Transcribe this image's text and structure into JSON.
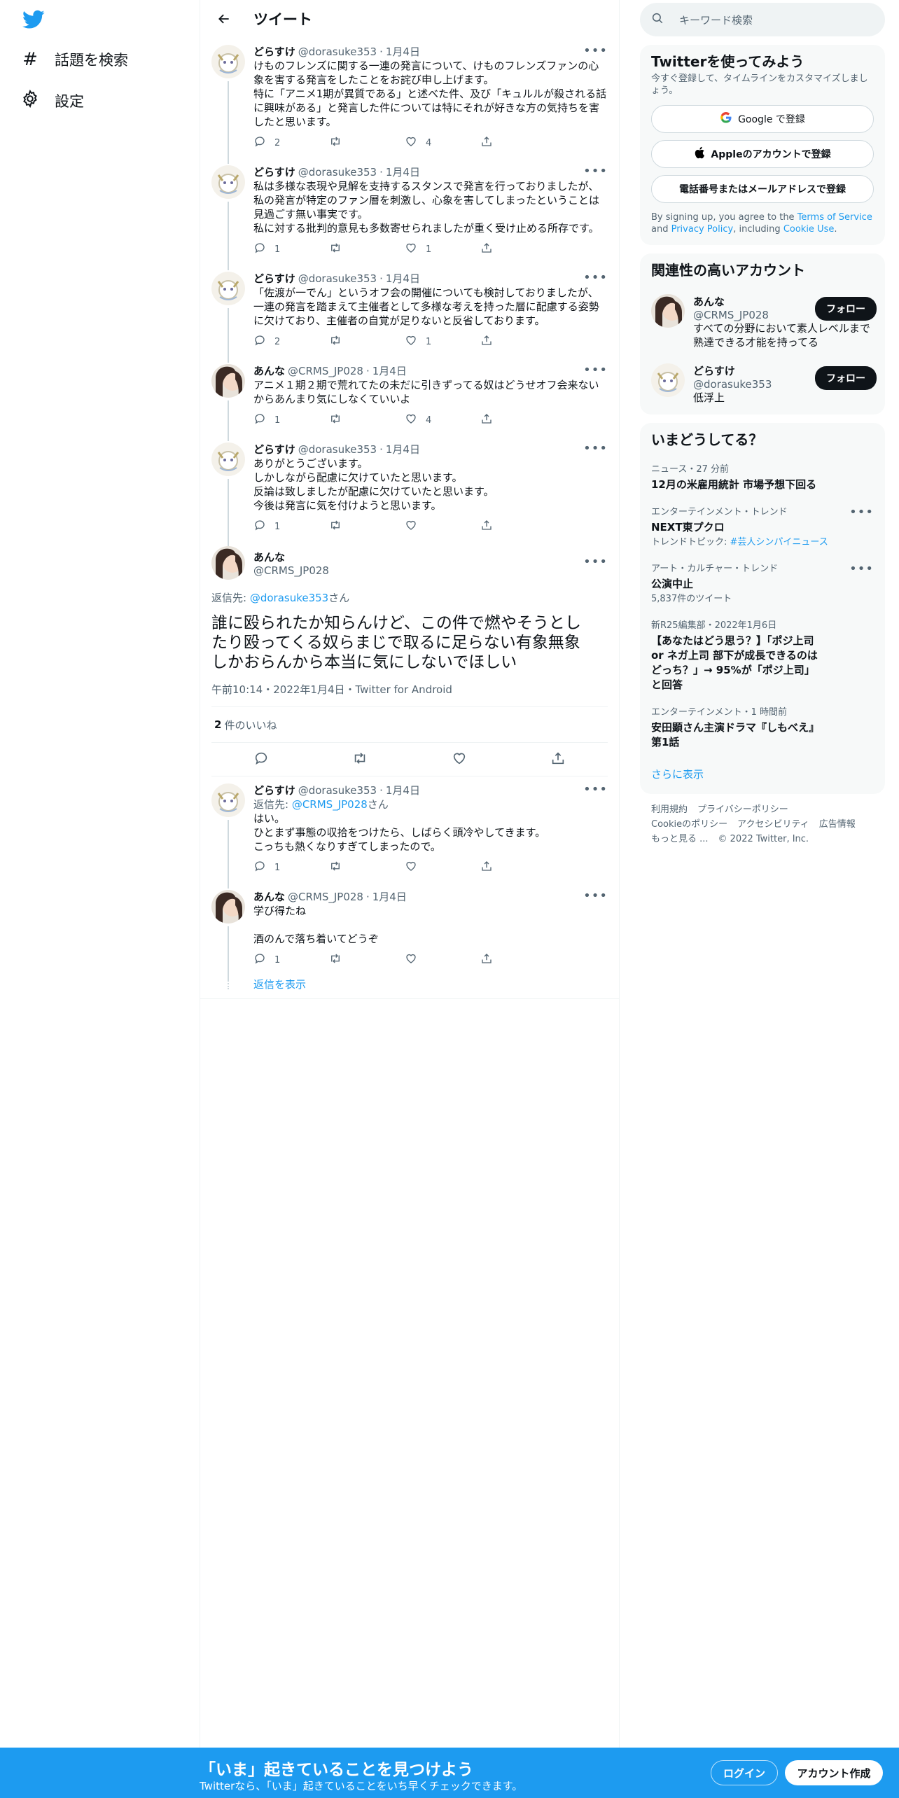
{
  "nav": {
    "explore_label": "話題を検索",
    "settings_label": "設定"
  },
  "header": {
    "title": "ツイート"
  },
  "thread": [
    {
      "name": "どらすけ",
      "handle": "@dorasuke353",
      "date": "1月4日",
      "avatar": "dorasuke",
      "text": "けものフレンズに関する一連の発言について、けものフレンズファンの心\n象を害する発言をしたことをお詫び申し上げます。\n特に「アニメ1期が異質である」と述べた件、及び「キュルルが殺される話\nに興味がある」と発言した件については特にそれが好きな方の気持ちを害\nしたと思います。",
      "replies": "2",
      "retweets": "",
      "likes": "4"
    },
    {
      "name": "どらすけ",
      "handle": "@dorasuke353",
      "date": "1月4日",
      "avatar": "dorasuke",
      "text": "私は多様な表現や見解を支持するスタンスで発言を行っておりましたが、\n私の発言が特定のファン層を刺激し、心象を害してしまったということは\n見過ごす無い事実です。\n私に対する批判的意見も多数寄せられましたが重く受け止める所存です。",
      "replies": "1",
      "retweets": "",
      "likes": "1"
    },
    {
      "name": "どらすけ",
      "handle": "@dorasuke353",
      "date": "1月4日",
      "avatar": "dorasuke",
      "text": "「佐渡が一でん」というオフ会の開催についても検討しておりましたが、\n一連の発言を踏まえて主催者として多様な考えを持った層に配慮する姿勢\nに欠けており、主催者の自覚が足りないと反省しております。",
      "replies": "2",
      "retweets": "",
      "likes": "1"
    },
    {
      "name": "あんな",
      "handle": "@CRMS_JP028",
      "date": "1月4日",
      "avatar": "anna",
      "text": "アニメ１期２期で荒れてたの未だに引きずってる奴はどうせオフ会来ない\nからあんまり気にしなくていいよ",
      "replies": "1",
      "retweets": "",
      "likes": "4"
    },
    {
      "name": "どらすけ",
      "handle": "@dorasuke353",
      "date": "1月4日",
      "avatar": "dorasuke",
      "text": "ありがとうございます。\nしかしながら配慮に欠けていたと思います。\n反論は致しましたが配慮に欠けていたと思います。\n今後は発言に気を付けようと思います。",
      "replies": "1",
      "retweets": "",
      "likes": ""
    }
  ],
  "main_tweet": {
    "name": "あんな",
    "handle": "@CRMS_JP028",
    "reply_prefix": "返信先: ",
    "reply_to": "@dorasuke353",
    "reply_suffix": "さん",
    "text": "誰に殴られたか知らんけど、この件で燃やそうとし\nたり殴ってくる奴らまじで取るに足らない有象無象\nしかおらんから本当に気にしないでほしい",
    "time": "午前10:14・2022年1月4日・Twitter for Android",
    "likes_count": "2",
    "likes_label": "件のいいね"
  },
  "replies": [
    {
      "name": "どらすけ",
      "handle": "@dorasuke353",
      "date": "1月4日",
      "avatar": "dorasuke",
      "reply_prefix": "返信先: ",
      "reply_to": "@CRMS_JP028",
      "reply_suffix": "さん",
      "text": "はい。\nひとまず事態の収拾をつけたら、しばらく頭冷やしてきます。\nこっちも熱くなりすぎてしまったので。",
      "replies": "1",
      "retweets": "",
      "likes": ""
    },
    {
      "name": "あんな",
      "handle": "@CRMS_JP028",
      "date": "1月4日",
      "avatar": "anna",
      "text": "学び得たね\n\n酒のんで落ち着いてどうぞ",
      "replies": "1",
      "retweets": "",
      "likes": ""
    }
  ],
  "show_replies": "返信を表示",
  "sidebar": {
    "search_placeholder": "キーワード検索",
    "signup": {
      "title": "Twitterを使ってみよう",
      "subtitle": "今すぐ登録して、タイムラインをカスタマイズしましょう。",
      "google": "Google で登録",
      "apple": "Appleのアカウントで登録",
      "phone": "電話番号またはメールアドレスで登録",
      "terms_pre": "By signing up, you agree to the ",
      "terms": "Terms of Service",
      "terms_and": " and ",
      "privacy": "Privacy Policy",
      "including": ", including ",
      "cookie": "Cookie Use",
      "end": "."
    },
    "related": {
      "title": "関連性の高いアカウント",
      "follow": "フォロー",
      "accounts": [
        {
          "name": "あんな",
          "handle": "@CRMS_JP028",
          "bio": "すべての分野において素人レベルまで熟達できる才能を持ってる"
        },
        {
          "name": "どらすけ",
          "handle": "@dorasuke353",
          "bio": "低浮上"
        }
      ]
    },
    "trends": {
      "title": "いまどうしてる？",
      "items": [
        {
          "cat": "ニュース・27 分前",
          "name": "12月の米雇用統計 市場予想下回る",
          "sub": ""
        },
        {
          "cat": "エンターテインメント・トレンド",
          "name": "NEXT東プクロ",
          "sub": "トレンドトピック: ",
          "link": "#芸人シンパイニュース"
        },
        {
          "cat": "アート・カルチャー・トレンド",
          "name": "公演中止",
          "sub": "5,837件のツイート"
        },
        {
          "cat": "新R25編集部・2022年1月6日",
          "name": "【あなたはどう思う？】「ポジ上司 or ネガ上司 部下が成長できるのはどっち？」→ 95%が「ポジ上司」と回答",
          "sub": ""
        },
        {
          "cat": "エンターテインメント・1 時間前",
          "name": "安田顕さん主演ドラマ『しもべえ』第1話",
          "sub": ""
        }
      ],
      "more": "さらに表示"
    },
    "footer": [
      "利用規約",
      "プライバシーポリシー",
      "Cookieのポリシー",
      "アクセシビリティ",
      "広告情報",
      "もっと見る ...",
      "© 2022 Twitter, Inc."
    ]
  },
  "bottom": {
    "title": "「いま」起きていることを見つけよう",
    "subtitle": "Twitterなら、「いま」起きていることをいち早くチェックできます。",
    "login": "ログイン",
    "signup": "アカウント作成"
  },
  "colors": {
    "accent": "#1d9bf0",
    "text": "#0f1419",
    "muted": "#536471"
  }
}
